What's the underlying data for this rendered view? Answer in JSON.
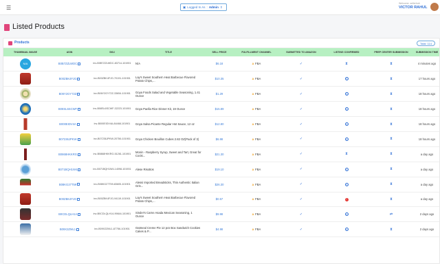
{
  "header": {
    "logged_in_label": "Logged In As",
    "logged_in_user": "Admin",
    "welcome_text": "Welcome, sellerhub",
    "user_name": "VICTOR RAHUL"
  },
  "page": {
    "title": "Listed Products"
  },
  "card": {
    "title": "Products",
    "total": "Total: 114"
  },
  "table": {
    "columns": [
      "Thumbnail Image",
      "ASIN",
      "SKU",
      "Title",
      "Sell Price",
      "Fulfillment Channel",
      "Submitted to Amazon",
      "Listing Confirmed",
      "Prep Center Submission",
      "Submission Time"
    ],
    "rows": [
      {
        "thumb": "na",
        "thumb_text": "N/A",
        "asin": "B0B7ZZLWDC",
        "sku": "inv-B0B7ZZLWDC-83714-101901",
        "title": "N/A",
        "price": "$6.18",
        "channel": "FBA",
        "submitted": "check",
        "confirmed": "hourglass",
        "prep": "hourglass",
        "time": "4 minutes ago"
      },
      {
        "thumb": "t-red",
        "asin": "B00ZBK4FJG",
        "sku": "inv-B00ZBK4FJG-70191-101901",
        "title": "Lay's Sweet Southern Heat Barbecue Flavored Potato Chips,...",
        "price": "$10.35",
        "channel": "FBA",
        "submitted": "check",
        "confirmed": "clock",
        "prep": "hourglass",
        "time": "17 hours ago"
      },
      {
        "thumb": "t-plate",
        "asin": "B06Y2GY72Z",
        "sku": "inv-B06Y2GY72Z-33654-101901",
        "title": "Goya Foods Salad and Vegetable Seasoning, 1.41 Ounce",
        "price": "$1.29",
        "channel": "FBA",
        "submitted": "check",
        "confirmed": "clock",
        "prep": "hourglass",
        "time": "18 hours ago"
      },
      {
        "thumb": "t-blue",
        "asin": "B08SL6SCWF",
        "sku": "inv-B08SL6SCWF-32223-101901",
        "title": "Goya Paella Rice Dinner Kit, 19 Ounce",
        "price": "$15.89",
        "channel": "FBA",
        "submitted": "check",
        "confirmed": "clock",
        "prep": "hourglass",
        "time": "18 hours ago"
      },
      {
        "thumb": "t-bottle",
        "asin": "B000EIDV4A",
        "sku": "inv-B000EIDV4A-84468-101901",
        "title": "Goya Salsa Picante Regular Hot Sauce, 12 oz",
        "price": "$12.80",
        "channel": "FBA",
        "submitted": "check",
        "confirmed": "clock",
        "prep": "hourglass",
        "time": "18 hours ago"
      },
      {
        "thumb": "t-yellow",
        "asin": "B07236JPKW",
        "sku": "inv-B07236JPKW-20756-101901",
        "title": "Goya Chicken Bouillon Cubes 2.82 OZ(Pack of 3)",
        "price": "$6.98",
        "channel": "FBA",
        "submitted": "check",
        "confirmed": "clock",
        "prep": "hourglass",
        "time": "18 hours ago"
      },
      {
        "thumb": "t-sauce",
        "asin": "B0868HKKRG",
        "sku": "inv-B0868HKKRG-51261-101901",
        "title": "Monin - Raspberry Syrup, Sweet and Tart, Great for Cockt...",
        "price": "$21.30",
        "channel": "FBA",
        "submitted": "check",
        "confirmed": "hourglass",
        "prep": "hourglass",
        "time": "a day ago"
      },
      {
        "thumb": "t-round",
        "asin": "B071BQH1W4",
        "sku": "inv-B071BQH1W4-14098-101901",
        "title": "Alese Risottos",
        "price": "$19.10",
        "channel": "FBA",
        "submitted": "check",
        "confirmed": "clock",
        "prep": "hourglass",
        "time": "a day ago"
      },
      {
        "thumb": "t-pack",
        "asin": "B08KG27T59",
        "sku": "inv-B08KG27T59-83605-101901",
        "title": "Alessi Imported Breadsticks, Thin Authentic Italian Gris...",
        "price": "$26.30",
        "channel": "FBA",
        "submitted": "check",
        "confirmed": "clock",
        "prep": "hourglass",
        "time": "a day ago"
      },
      {
        "thumb": "t-red",
        "asin": "B00ZBK4FJG",
        "sku": "inv-B00ZBK4FJG-94119-101901",
        "title": "Lay's Sweet Southern Heat Barbecue Flavored Potato Chips,...",
        "price": "$0.57",
        "channel": "FBA",
        "submitted": "check",
        "confirmed": "error",
        "prep": "hourglass",
        "time": "a day ago"
      },
      {
        "thumb": "t-dark",
        "asin": "B0CDLQLH14",
        "sku": "inv-B0CDLQLH14-99844-101901",
        "title": "Sinder's Carne Asada Mexican Seasoning, 1 Ounce",
        "price": "$9.98",
        "channel": "FBA",
        "submitted": "check",
        "confirmed": "clock",
        "prep": "swap",
        "time": "2 days ago"
      },
      {
        "thumb": "t-cream",
        "asin": "B09X2ZML1",
        "sku": "inv-B09X2ZML1-87756-101901",
        "title": "Oatmeal Creme Pie 12 pcs Box Sandwich Cookies Cakes & P...",
        "price": "$4.98",
        "channel": "FBA",
        "submitted": "check",
        "confirmed": "clock",
        "prep": "hourglass",
        "time": "2 days ago"
      }
    ]
  },
  "colors": {
    "accent": "#2f6fd6",
    "header_row": "#b7f0c2",
    "success": "#1fa36b",
    "error": "#e53935",
    "brand_pink": "#e0457b"
  }
}
